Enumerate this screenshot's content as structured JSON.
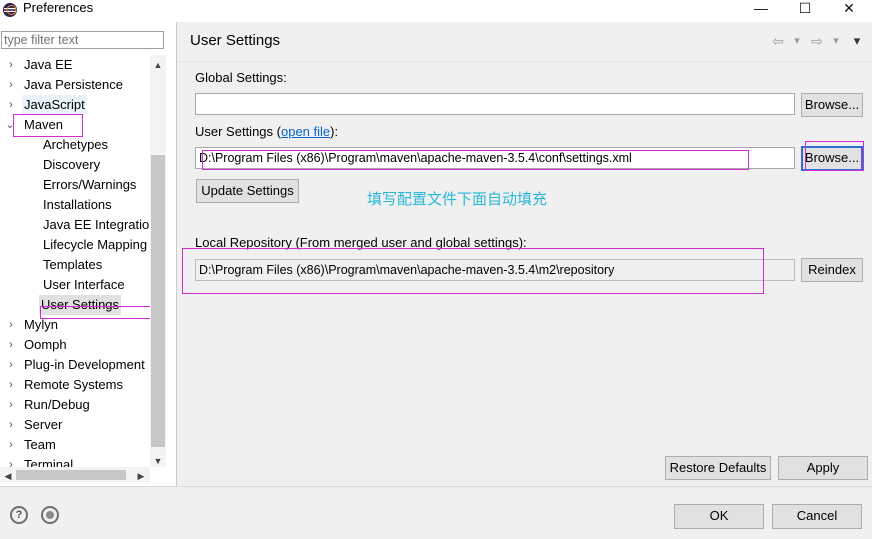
{
  "window": {
    "title": "Preferences",
    "minimize": "—",
    "maximize": "☐",
    "close": "✕"
  },
  "filter": {
    "placeholder": "type filter text"
  },
  "tree": [
    {
      "label": "Java EE",
      "expander": "›"
    },
    {
      "label": "Java Persistence",
      "expander": "›"
    },
    {
      "label": "JavaScript",
      "expander": "›"
    },
    {
      "label": "Maven",
      "expander": "⌄"
    },
    {
      "label": "Archetypes",
      "expander": ""
    },
    {
      "label": "Discovery",
      "expander": ""
    },
    {
      "label": "Errors/Warnings",
      "expander": ""
    },
    {
      "label": "Installations",
      "expander": ""
    },
    {
      "label": "Java EE Integration",
      "expander": ""
    },
    {
      "label": "Lifecycle Mapping",
      "expander": ""
    },
    {
      "label": "Templates",
      "expander": ""
    },
    {
      "label": "User Interface",
      "expander": ""
    },
    {
      "label": "User Settings",
      "expander": ""
    },
    {
      "label": "Mylyn",
      "expander": "›"
    },
    {
      "label": "Oomph",
      "expander": "›"
    },
    {
      "label": "Plug-in Development",
      "expander": "›"
    },
    {
      "label": "Remote Systems",
      "expander": "›"
    },
    {
      "label": "Run/Debug",
      "expander": "›"
    },
    {
      "label": "Server",
      "expander": "›"
    },
    {
      "label": "Team",
      "expander": "›"
    },
    {
      "label": "Terminal",
      "expander": "›"
    }
  ],
  "scroll": {
    "up": "▲",
    "down": "▼",
    "left": "◀",
    "right": "▶"
  },
  "page": {
    "title": "User Settings",
    "nav": {
      "back": "⇦",
      "forward": "⇨",
      "dropdown": "▾",
      "menu": "▾"
    },
    "global_settings_label": "Global Settings:",
    "global_settings_value": "",
    "browse1": "Browse...",
    "user_settings_label_pre": "User Settings (",
    "user_settings_link": "open file",
    "user_settings_label_post": "):",
    "user_settings_value": "D:\\Program Files (x86)\\Program\\maven\\apache-maven-3.5.4\\conf\\settings.xml",
    "browse2": "Browse...",
    "update_settings": "Update Settings",
    "annotation": "填写配置文件下面自动填充",
    "local_repo_label": "Local Repository (From merged user and global settings):",
    "local_repo_value": "D:\\Program Files (x86)\\Program\\maven\\apache-maven-3.5.4\\m2\\repository",
    "reindex": "Reindex",
    "restore_defaults": "Restore Defaults",
    "apply": "Apply"
  },
  "footer": {
    "help": "?",
    "ok": "OK",
    "cancel": "Cancel"
  },
  "colors": {
    "annotation": "#29b8d6",
    "highlight_box": "#d12dd1",
    "focus": "#2f6fd0",
    "link": "#0066cc"
  }
}
